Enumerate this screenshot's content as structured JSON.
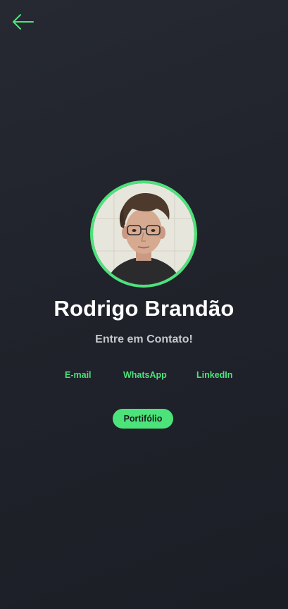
{
  "header": {
    "back_icon": "arrow-left-icon"
  },
  "profile": {
    "avatar_icon": "profile-photo",
    "name": "Rodrigo Brandão",
    "subtitle": "Entre em Contato!"
  },
  "contacts": {
    "email_label": "E-mail",
    "whatsapp_label": "WhatsApp",
    "linkedin_label": "LinkedIn"
  },
  "actions": {
    "portfolio_label": "Portifólio"
  },
  "colors": {
    "accent": "#4ce37a",
    "background": "#22252d",
    "text_primary": "#ffffff",
    "text_secondary": "#c7c8ce"
  }
}
